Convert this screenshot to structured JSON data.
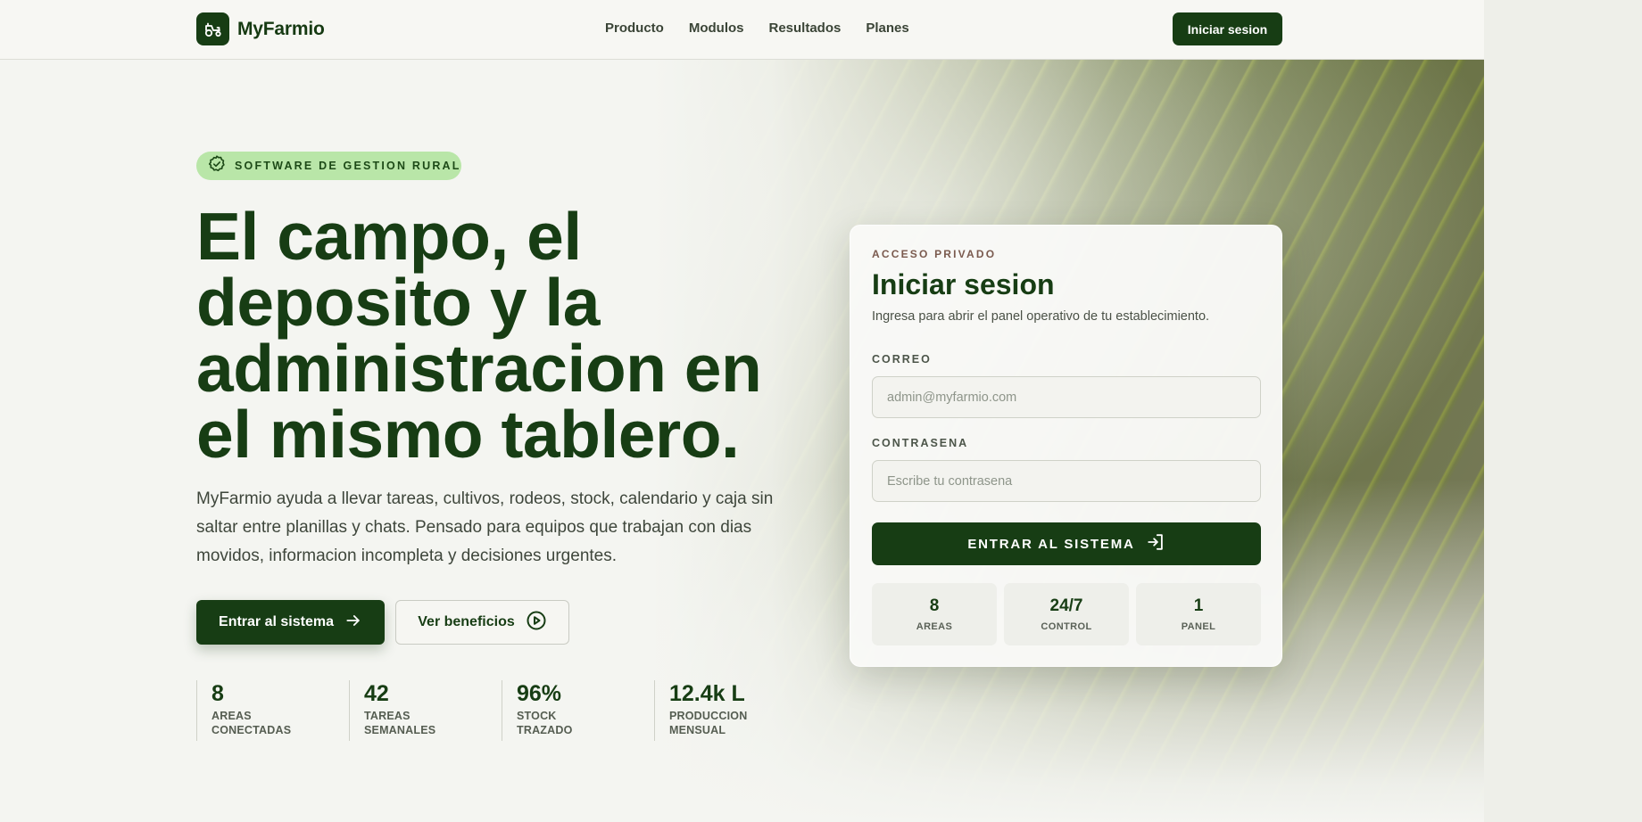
{
  "nav": {
    "brand": "MyFarmio",
    "links": [
      "Producto",
      "Modulos",
      "Resultados",
      "Planes"
    ],
    "cta": "Iniciar sesion"
  },
  "hero": {
    "badge": "SOFTWARE DE GESTION RURAL",
    "headline": [
      "El campo, el",
      "deposito y la",
      "administracion en",
      "el mismo tablero."
    ],
    "lead": "MyFarmio ayuda a llevar tareas, cultivos, rodeos, stock, calendario y caja sin saltar entre planillas y chats. Pensado para equipos que trabajan con dias movidos, informacion incompleta y decisiones urgentes.",
    "primary_button": "Entrar al sistema",
    "secondary_button": "Ver beneficios",
    "stats": [
      {
        "value": "8",
        "label": "AREAS CONECTADAS"
      },
      {
        "value": "42",
        "label": "TAREAS SEMANALES"
      },
      {
        "value": "96%",
        "label": "STOCK TRAZADO"
      },
      {
        "value": "12.4k L",
        "label": "PRODUCCION MENSUAL"
      }
    ]
  },
  "login": {
    "eyebrow": "ACCESO PRIVADO",
    "title": "Iniciar sesion",
    "subtitle": "Ingresa para abrir el panel operativo de tu establecimiento.",
    "email_label": "CORREO",
    "email_placeholder": "admin@myfarmio.com",
    "password_label": "CONTRASENA",
    "password_placeholder": "Escribe tu contrasena",
    "submit": "ENTRAR AL SISTEMA",
    "mini_stats": [
      {
        "value": "8",
        "label": "AREAS"
      },
      {
        "value": "24/7",
        "label": "CONTROL"
      },
      {
        "value": "1",
        "label": "PANEL"
      }
    ]
  },
  "colors": {
    "brand_dark": "#173d14",
    "badge_bg": "#b9e6a8",
    "page_bg": "#f4f5f1"
  },
  "icons": {
    "brand": "tractor-icon",
    "badge": "verified-badge-icon",
    "primary_button": "arrow-right-icon",
    "secondary_button": "play-circle-icon",
    "submit": "login-icon"
  }
}
